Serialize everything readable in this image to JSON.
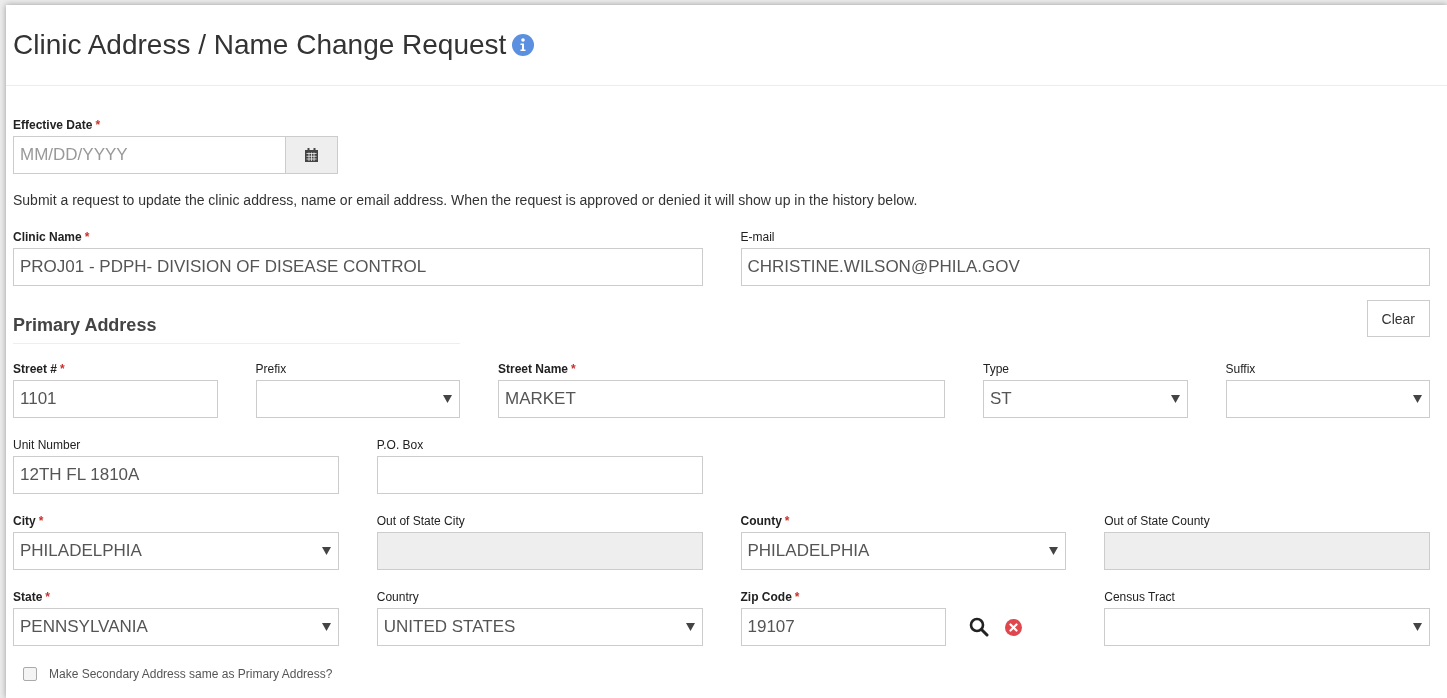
{
  "title": "Clinic Address / Name Change Request",
  "required_mark": "*",
  "effective_date": {
    "label": "Effective Date",
    "required": true,
    "placeholder": "MM/DD/YYYY"
  },
  "intro": "Submit a request to update the clinic address, name or email address. When the request is approved or denied it will show up in the history below.",
  "clinic_fields": [
    {
      "label": "Clinic Name",
      "required": true,
      "kind": "text",
      "disabled": false,
      "value": "PROJ01 - PDPH- DIVISION OF DISEASE CONTROL"
    },
    {
      "label": "E-mail",
      "required": false,
      "kind": "text",
      "disabled": false,
      "value": "CHRISTINE.WILSON@PHILA.GOV"
    }
  ],
  "primary_address": {
    "heading": "Primary Address",
    "clear_button": "Clear",
    "rows": [
      [
        {
          "label": "Street #",
          "required": true,
          "kind": "text",
          "disabled": false,
          "value": "1101"
        },
        {
          "label": "Prefix",
          "required": false,
          "kind": "select",
          "disabled": false
        },
        {
          "label": "Street Name",
          "required": true,
          "kind": "text",
          "disabled": false,
          "value": "MARKET"
        },
        {
          "label": "Type",
          "required": false,
          "kind": "select",
          "disabled": false,
          "value": "ST"
        },
        {
          "label": "Suffix",
          "required": false,
          "kind": "select",
          "disabled": false
        }
      ],
      [
        {
          "label": "Unit Number",
          "required": false,
          "kind": "text",
          "disabled": false,
          "value": "12TH FL 1810A"
        },
        {
          "label": "P.O. Box",
          "required": false,
          "kind": "text",
          "disabled": false
        }
      ],
      [
        {
          "label": "City",
          "required": true,
          "kind": "select",
          "disabled": false,
          "value": "PHILADELPHIA"
        },
        {
          "label": "Out of State City",
          "required": false,
          "kind": "text",
          "disabled": true
        },
        {
          "label": "County",
          "required": true,
          "kind": "select",
          "disabled": false,
          "value": "PHILADELPHIA"
        },
        {
          "label": "Out of State County",
          "required": false,
          "kind": "text",
          "disabled": true
        }
      ],
      [
        {
          "label": "State",
          "required": true,
          "kind": "select",
          "disabled": false,
          "value": "PENNSYLVANIA"
        },
        {
          "label": "Country",
          "required": false,
          "kind": "select",
          "disabled": false,
          "value": "UNITED STATES"
        },
        {
          "label": "Zip Code",
          "required": true,
          "kind": "lookup",
          "disabled": false,
          "value": "19107"
        },
        {
          "label": "Census Tract",
          "required": false,
          "kind": "select",
          "disabled": false
        }
      ]
    ]
  },
  "same_address": {
    "label": "Make Secondary Address same as Primary Address?",
    "checked": false
  }
}
